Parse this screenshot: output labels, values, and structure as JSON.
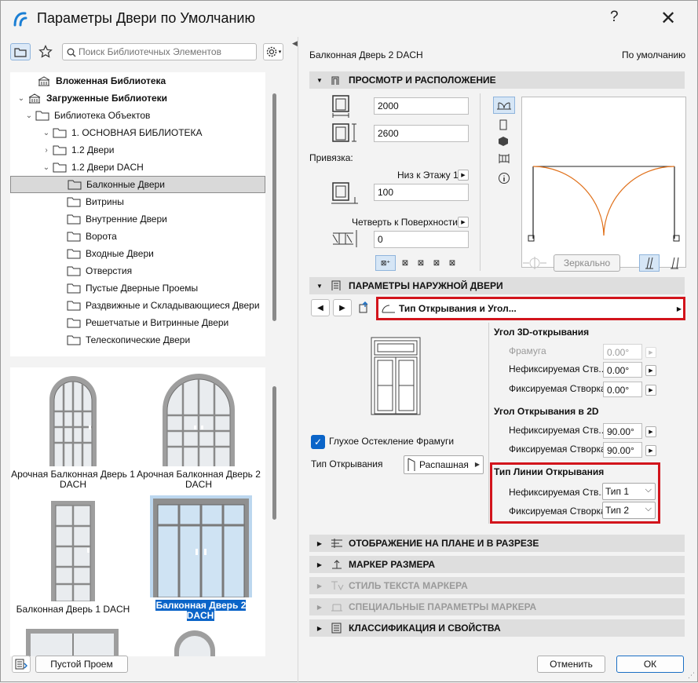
{
  "window": {
    "title": "Параметры Двери по Умолчанию",
    "help": "?",
    "close": "✕"
  },
  "left": {
    "search_placeholder": "Поиск Библиотечных Элементов",
    "tree": [
      {
        "label": "Вложенная Библиотека",
        "bold": true
      },
      {
        "label": "Загруженные Библиотеки",
        "bold": true
      },
      {
        "label": "Библиотека Объектов"
      },
      {
        "label": "1. ОСНОВНАЯ БИБЛИОТЕКА"
      },
      {
        "label": "1.2 Двери"
      },
      {
        "label": "1.2 Двери DACH"
      },
      {
        "label": "Балконные Двери",
        "selected": true
      },
      {
        "label": "Витрины"
      },
      {
        "label": "Внутренние Двери"
      },
      {
        "label": "Ворота"
      },
      {
        "label": "Входные Двери"
      },
      {
        "label": "Отверстия"
      },
      {
        "label": "Пустые Дверные Проемы"
      },
      {
        "label": "Раздвижные и Складывающиеся Двери"
      },
      {
        "label": "Решетчатые и Витринные Двери"
      },
      {
        "label": "Телескопические Двери"
      }
    ],
    "thumbs": [
      {
        "line1": "Арочная Балконная Дверь 1",
        "line2": "DACH"
      },
      {
        "line1": "Арочная Балконная Дверь 2",
        "line2": "DACH"
      },
      {
        "line1": "Балконная Дверь 1 DACH",
        "line2": ""
      },
      {
        "line1": "Балконная Дверь 2 DACH",
        "line2": "",
        "selected": true
      }
    ],
    "empty_opening_button": "Пустой Проем"
  },
  "right": {
    "element_name": "Балконная Дверь 2 DACH",
    "default_label": "По умолчанию",
    "sections": {
      "preview": "ПРОСМОТР И РАСПОЛОЖЕНИЕ",
      "outer_door": "ПАРАМЕТРЫ НАРУЖНОЙ ДВЕРИ",
      "plan": "ОТОБРАЖЕНИЕ НА ПЛАНЕ И В РАЗРЕЗЕ",
      "dimension": "МАРКЕР РАЗМЕРА",
      "text_style": "СТИЛЬ ТЕКСТА МАРКЕРА",
      "special": "СПЕЦИАЛЬНЫЕ ПАРАМЕТРЫ МАРКЕРА",
      "classification": "КЛАССИФИКАЦИЯ И СВОЙСТВА"
    },
    "width": "2000",
    "height": "2600",
    "anchor_label": "Привязка:",
    "anchor_mode": "Низ к Этажу 1",
    "sill": "100",
    "reveal_mode": "Четверть к Поверхности",
    "reveal": "0",
    "mirror_button": "Зеркально",
    "page_selector": "Тип Открывания и Угол...",
    "angle3d_title": "Угол 3D-открывания",
    "transom_label": "Фрамуга",
    "transom_value": "0.00°",
    "unfixed_label": "Нефиксируемая Ств...",
    "unfixed_3d": "0.00°",
    "fixed_label": "Фиксируемая Створка",
    "fixed_3d": "0.00°",
    "angle2d_title": "Угол Открывания в 2D",
    "unfixed_2d": "90.00°",
    "fixed_2d": "90.00°",
    "glazing_label": "Глухое Остекление Фрамуги",
    "opening_type_label": "Тип Открывания",
    "opening_type_value": "Распашная",
    "line_type_title": "Тип Линии Открывания",
    "unfixed_line": "Тип 1",
    "fixed_line": "Тип 2"
  },
  "buttons": {
    "cancel": "Отменить",
    "ok": "ОК"
  }
}
